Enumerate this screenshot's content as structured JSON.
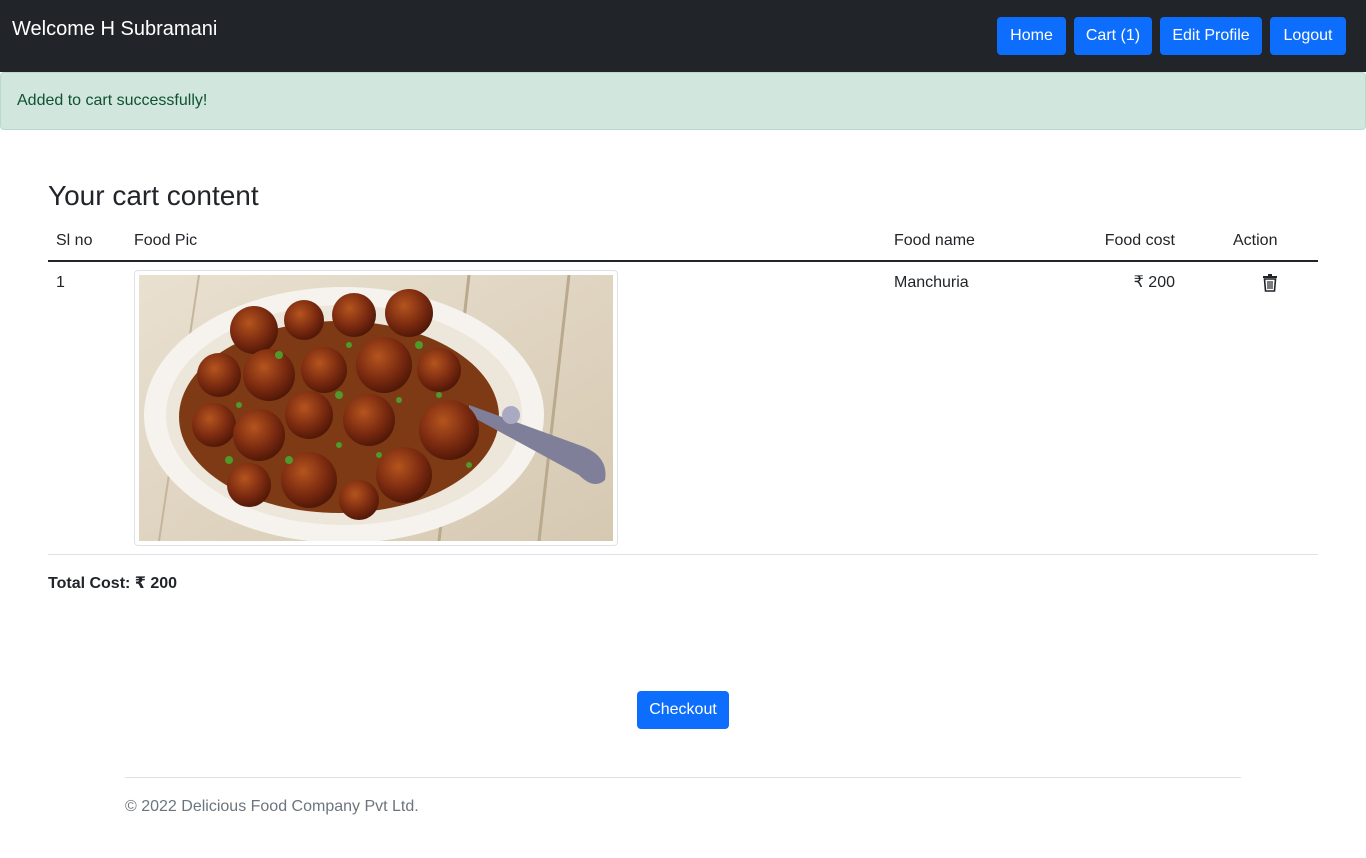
{
  "navbar": {
    "welcome": "Welcome H Subramani",
    "home_label": "Home",
    "cart_label": "Cart (1)",
    "edit_profile_label": "Edit Profile",
    "logout_label": "Logout"
  },
  "alert": {
    "message": "Added to cart successfully!"
  },
  "cart": {
    "heading": "Your cart content",
    "columns": [
      "Sl no",
      "Food Pic",
      "Food name",
      "Food cost",
      "Action"
    ],
    "rows": [
      {
        "sl_no": "1",
        "food_name": "Manchuria",
        "food_cost": "₹ 200",
        "action_icon": "trash-icon"
      }
    ],
    "total": "Total Cost: ₹ 200",
    "checkout_label": "Checkout"
  },
  "footer": {
    "text": "© 2022 Delicious Food Company Pvt Ltd."
  },
  "colors": {
    "navbar_bg": "#212529",
    "primary": "#0d6efd",
    "alert_bg": "#d1e7dd",
    "alert_text": "#0f5132",
    "muted": "#6c757d"
  }
}
